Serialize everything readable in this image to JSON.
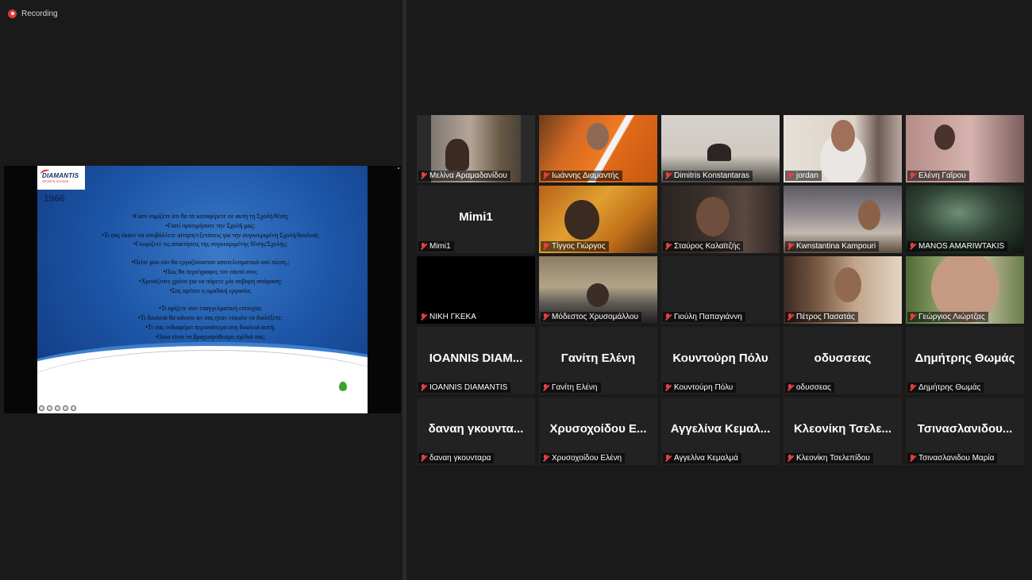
{
  "recording": {
    "label": "Recording"
  },
  "slide": {
    "logo_text": "DIAMANTIS",
    "logo_subtext": "SPORTS SCHOOL",
    "badge": "1966",
    "paragraph_1": [
      "•Γιατί νομίζετε ότι θα τα καταφέρετε σε αυτή τη Σχολή/θέση;",
      "•Γιατί προτιμήσατε την Σχολή μας;",
      "•Τι σας έκανε να υποβάλλετε αίτηση/εξετάσεις για την συγκεκριμένη Σχολή/δουλειά;",
      "•Γνωρίζετε τις απαιτήσεις της συγκεκριμένης θέσης/Σχολής;"
    ],
    "paragraph_2": [
      "•Πείτε μου εάν θα εργαζόσασταν αποτελεσματικά υπό πίεση.;",
      "•Πώς θα περιέγραφες τον εαυτό σου;",
      "•Χρειάζεστε  χρόνο για να πάρετε μία σοβαρή απόφαση;",
      "•Σας αρέσει η ομαδική εργασία;"
    ],
    "paragraph_3": [
      "•Τι ορίζετε σαν επαγγελματική επιτυχία;",
      "•Τι δουλειά θα κάνατε αν σας ήταν εύκολο να διαλέξετε;",
      "•Τι σας ενδιαφέρει περισσότερο στη δουλειά αυτή;",
      "•Ποια είναι τα βραχυπρόθεσμα σχέδιά σας;"
    ]
  },
  "participants": [
    {
      "name": "Μελίνα Αραμαδανίδου",
      "video": "melina"
    },
    {
      "name": "Ιωάννης Διαμαντής",
      "video": "iwannis"
    },
    {
      "name": "Dimitris Konstantaras",
      "video": "dimitris"
    },
    {
      "name": "jordan",
      "video": "jordan",
      "active": true
    },
    {
      "name": "Ελένη Γαΐρου",
      "video": "eleni"
    },
    {
      "name": "Mimi1",
      "display": "Mimi1"
    },
    {
      "name": "Τίγγος Γιώργος",
      "video": "tigos"
    },
    {
      "name": "Σταύρος Καλαϊτζής",
      "video": "stavros"
    },
    {
      "name": "Kwnstantina Kampouri",
      "video": "kwn"
    },
    {
      "name": "MANOS AMARIWTAKIS",
      "video": "manos"
    },
    {
      "name": "ΝΙΚΗ ΓΚΕΚΑ",
      "video": "black"
    },
    {
      "name": "Μόδεστος Χρυσομάλλου",
      "video": "modestos"
    },
    {
      "name": "Γιούλη Παπαγιάννη",
      "video": "blank"
    },
    {
      "name": "Πέτρος Πασατάς",
      "video": "petros"
    },
    {
      "name": "Γεώργιος Λιώρτζας",
      "video": "georgios"
    },
    {
      "name": "IOANNIS DIAMANTIS",
      "display": "IOANNIS  DIAM..."
    },
    {
      "name": "Γανίτη Ελένη",
      "display": "Γανίτη Ελένη"
    },
    {
      "name": "Κουντούρη Πόλυ",
      "display": "Κουντούρη Πόλυ"
    },
    {
      "name": "οδυσσεας",
      "display": "οδυσσεας"
    },
    {
      "name": "Δημήτρης Θωμάς",
      "display": "Δημήτρης Θωμάς"
    },
    {
      "name": "δαναη γκουνταρα",
      "display": "δαναη γκουντα..."
    },
    {
      "name": "Χρυσοχοίδου Ελένη",
      "display": "Χρυσοχοίδου Ε..."
    },
    {
      "name": "Αγγελίνα Κεμαλμά",
      "display": "Αγγελίνα Κεμαλ..."
    },
    {
      "name": "Κλεονίκη Τσελεπίδου",
      "display": "Κλεονίκη  Τσελε..."
    },
    {
      "name": "Τσινασλανιδου Μαρία",
      "display": "Τσινασλανιδου..."
    }
  ]
}
